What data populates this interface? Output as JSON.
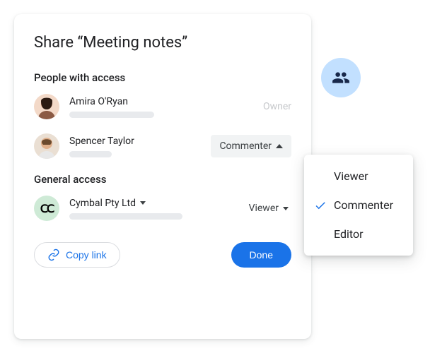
{
  "dialog": {
    "title": "Share “Meeting notes”",
    "people_section_label": "People with access",
    "general_section_label": "General access"
  },
  "people": [
    {
      "name": "Amira O'Ryan",
      "role": "Owner",
      "role_type": "owner"
    },
    {
      "name": "Spencer Taylor",
      "role": "Commenter",
      "role_type": "select"
    }
  ],
  "general": {
    "org_name": "Cymbal Pty Ltd",
    "role": "Viewer"
  },
  "buttons": {
    "copy_link": "Copy link",
    "done": "Done"
  },
  "menu": {
    "options": [
      "Viewer",
      "Commenter",
      "Editor"
    ],
    "selected": "Commenter"
  }
}
